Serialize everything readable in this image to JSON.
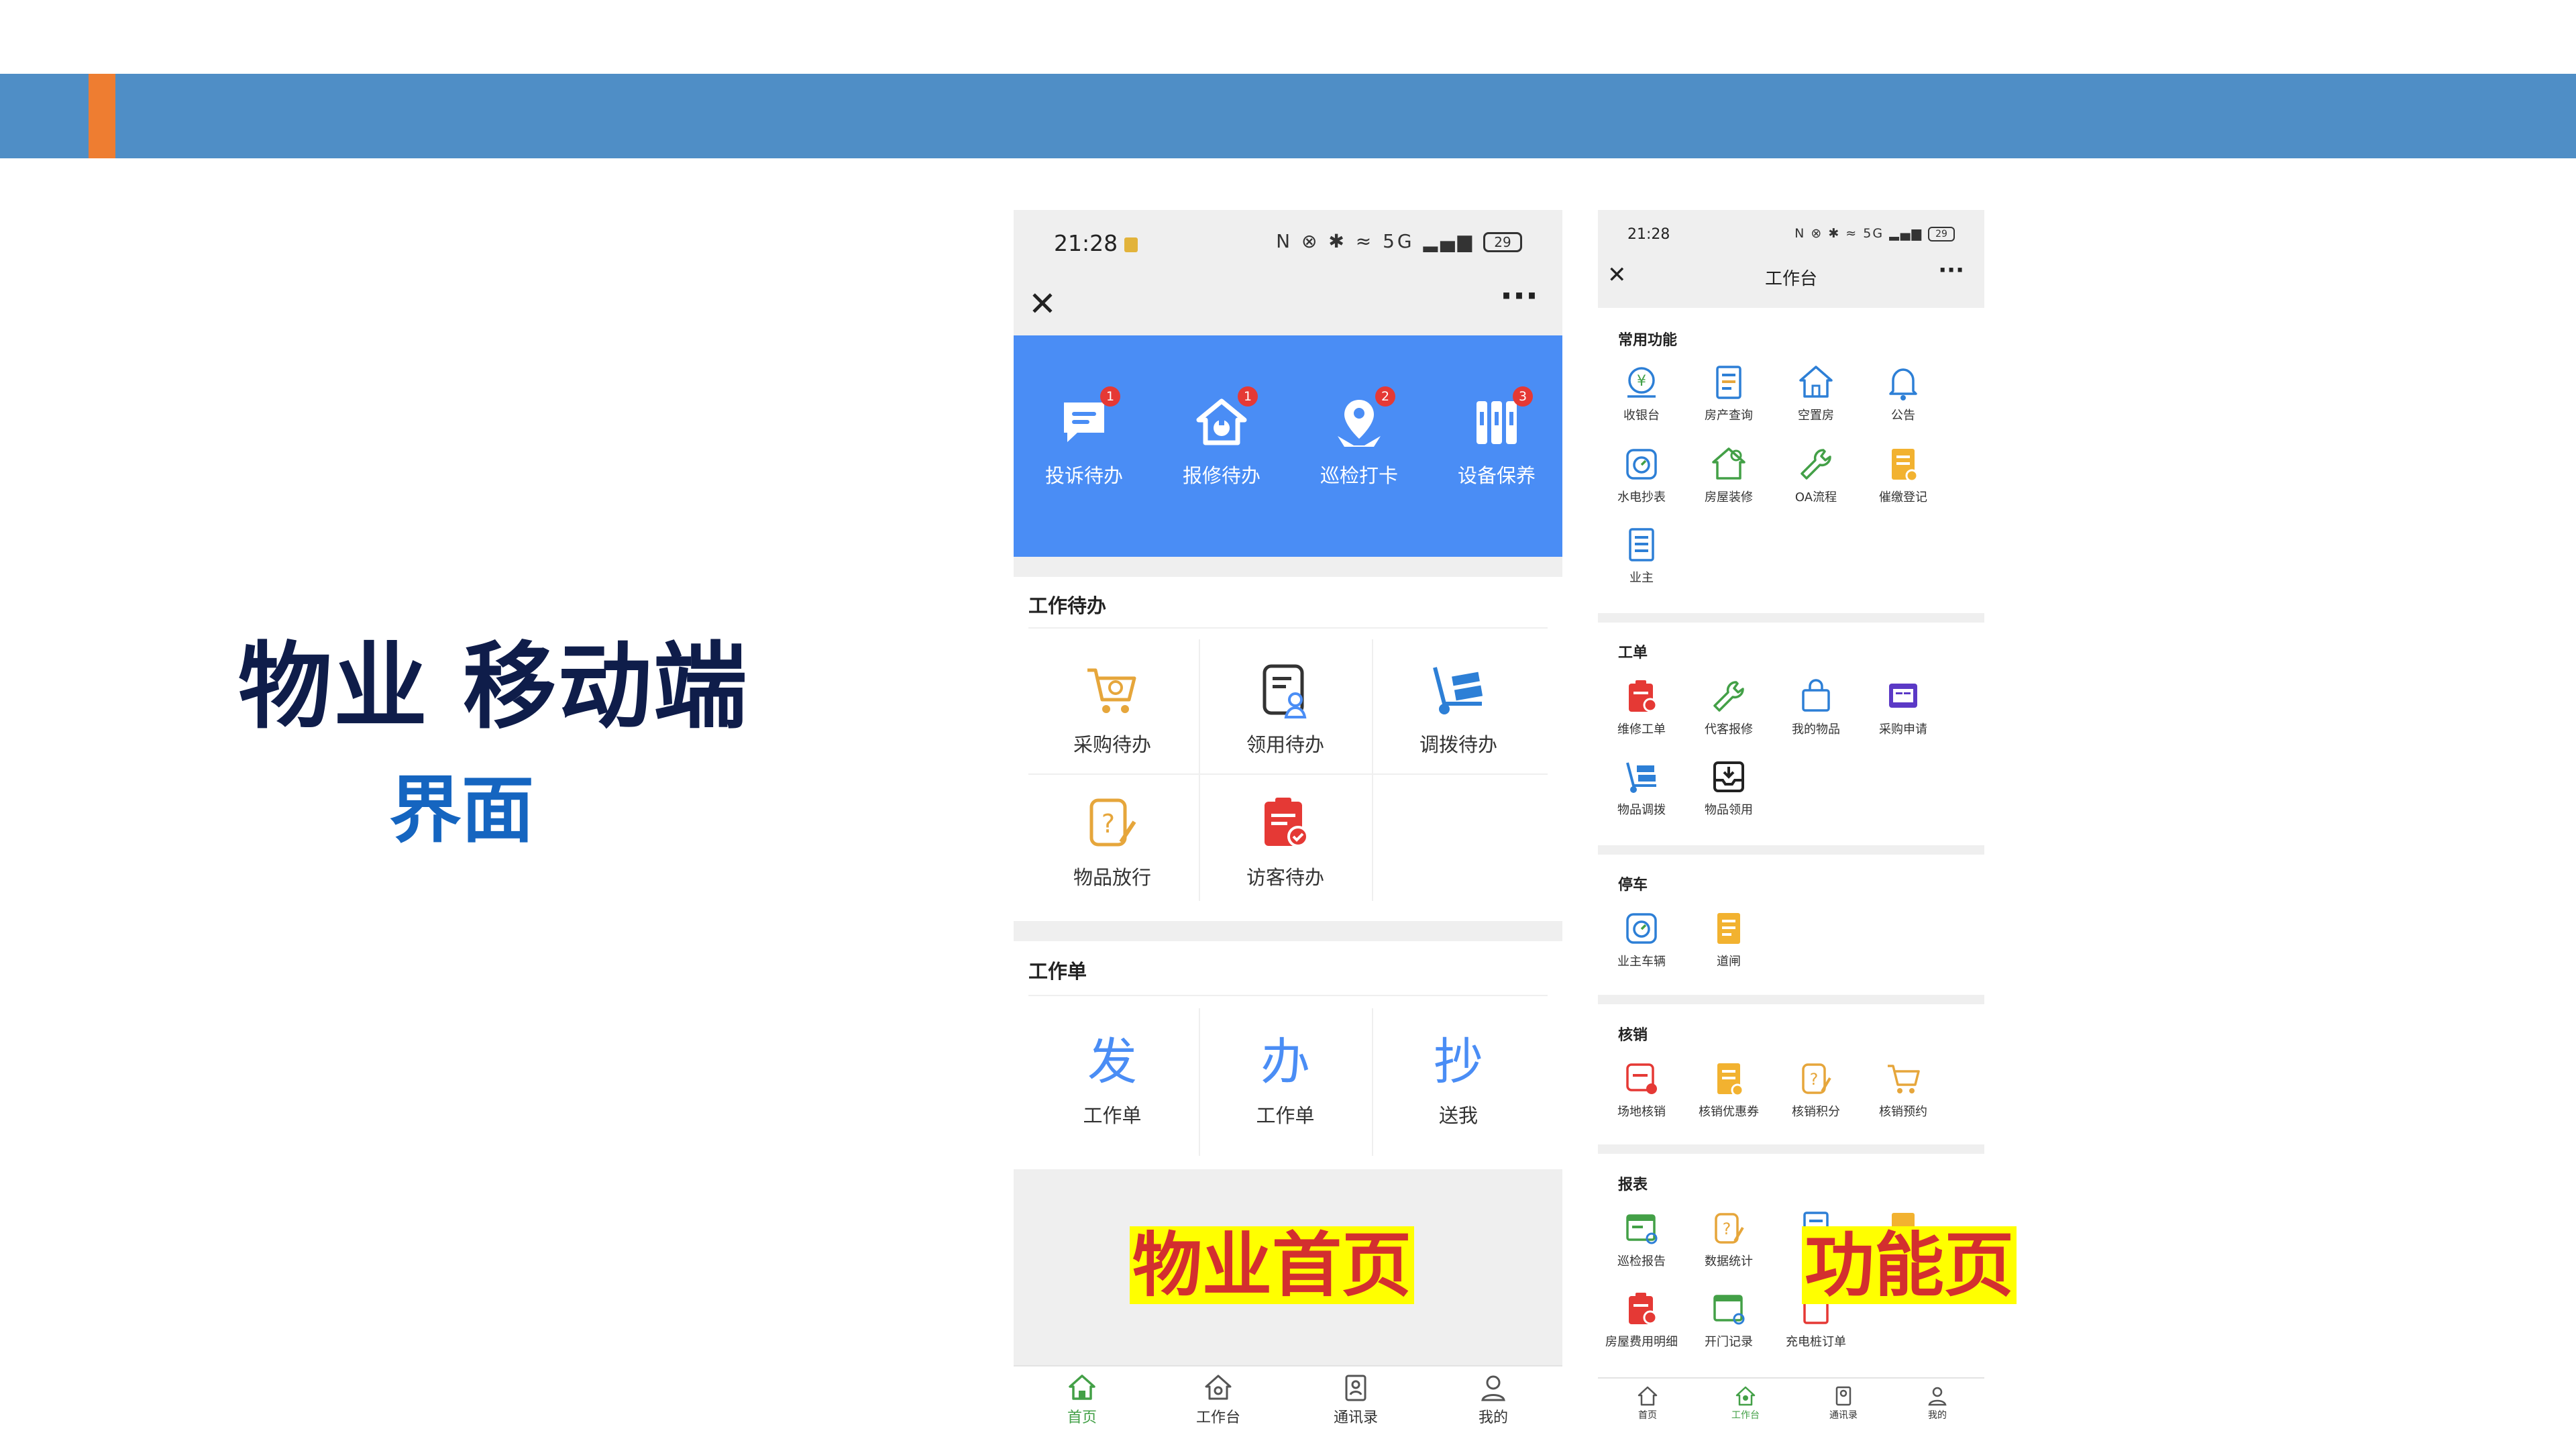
{
  "slide": {
    "title": "物业 移动端",
    "subtitle": "界面",
    "colors": {
      "bar": "#4f8ec6",
      "accent": "#ee7d31",
      "title": "#0f1d4a",
      "subtitle": "#1565c0"
    }
  },
  "home": {
    "status": {
      "time": "21:28",
      "icons": "N ⊗ ✱ ≈ 5G ▂▄▆",
      "battery": "29"
    },
    "hero": [
      {
        "label": "投诉待办",
        "badge": "1",
        "icon": "message-icon"
      },
      {
        "label": "报修待办",
        "badge": "1",
        "icon": "repair-home-icon"
      },
      {
        "label": "巡检打卡",
        "badge": "2",
        "icon": "location-person-icon"
      },
      {
        "label": "设备保养",
        "badge": "3",
        "icon": "equipment-icon"
      }
    ],
    "todo_title": "工作待办",
    "todo": [
      {
        "label": "采购待办",
        "icon": "cart-icon"
      },
      {
        "label": "领用待办",
        "icon": "document-user-icon"
      },
      {
        "label": "调拨待办",
        "icon": "hand-truck-icon"
      },
      {
        "label": "物品放行",
        "icon": "pass-question-icon"
      },
      {
        "label": "访客待办",
        "icon": "clipboard-check-icon"
      }
    ],
    "order_title": "工作单",
    "orders": [
      {
        "glyph": "发",
        "label": "工作单"
      },
      {
        "glyph": "办",
        "label": "工作单"
      },
      {
        "glyph": "抄",
        "label": "送我"
      }
    ],
    "tabs": [
      "首页",
      "工作台",
      "通讯录",
      "我的"
    ],
    "highlight": "物业首页"
  },
  "workbench": {
    "status": {
      "time": "21:28",
      "icons": "N ⊗ ✱ ≈ 5G ▂▄▆",
      "battery": "29"
    },
    "nav_title": "工作台",
    "sections": [
      {
        "title": "常用功能",
        "items": [
          "收银台",
          "房产查询",
          "空置房",
          "公告",
          "水电抄表",
          "房屋装修",
          "OA流程",
          "催缴登记",
          "业主"
        ]
      },
      {
        "title": "工单",
        "items": [
          "维修工单",
          "代客报修",
          "我的物品",
          "采购申请",
          "物品调拨",
          "物品领用"
        ]
      },
      {
        "title": "停车",
        "items": [
          "业主车辆",
          "道闸"
        ]
      },
      {
        "title": "核销",
        "items": [
          "场地核销",
          "核销优惠券",
          "核销积分",
          "核销预约"
        ]
      },
      {
        "title": "报表",
        "items": [
          "巡检报告",
          "数据统计",
          "",
          "",
          "房屋费用明细",
          "开门记录",
          "充电桩订单"
        ]
      }
    ],
    "tabs": [
      "首页",
      "工作台",
      "通讯录",
      "我的"
    ],
    "highlight": "功能页"
  }
}
